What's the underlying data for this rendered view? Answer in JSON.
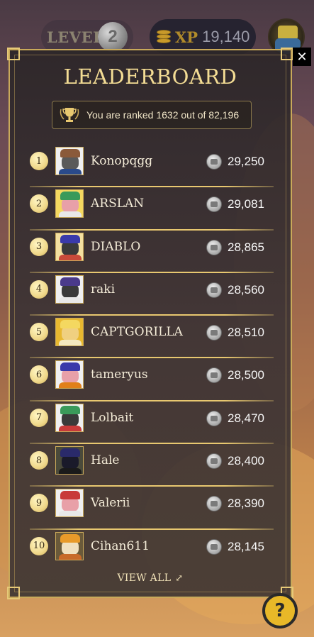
{
  "hud": {
    "level_label": "LEVEL",
    "level_value": "2",
    "xp_label": "XP",
    "xp_value": "19,140"
  },
  "leaderboard": {
    "title": "LEADERBOARD",
    "rank_text": "You are ranked 1632 out of 82,196",
    "view_all": "VIEW ALL",
    "close": "✕",
    "entries": [
      {
        "rank": "1",
        "name": "Konopqgg",
        "score": "29,250"
      },
      {
        "rank": "2",
        "name": "ARSLAN",
        "score": "29,081"
      },
      {
        "rank": "3",
        "name": "DIABLO",
        "score": "28,865"
      },
      {
        "rank": "4",
        "name": "raki",
        "score": "28,560"
      },
      {
        "rank": "5",
        "name": "CAPTGORILLA",
        "score": "28,510"
      },
      {
        "rank": "6",
        "name": "tameryus",
        "score": "28,500"
      },
      {
        "rank": "7",
        "name": "Lolbait",
        "score": "28,470"
      },
      {
        "rank": "8",
        "name": "Hale",
        "score": "28,400"
      },
      {
        "rank": "9",
        "name": "Valerii",
        "score": "28,390"
      },
      {
        "rank": "10",
        "name": "Cihan611",
        "score": "28,145"
      }
    ]
  },
  "help": {
    "label": "?"
  },
  "colors": {
    "accent_gold": "#e8c870",
    "title_gold": "#f3dc94",
    "help_yellow": "#e8b828"
  }
}
